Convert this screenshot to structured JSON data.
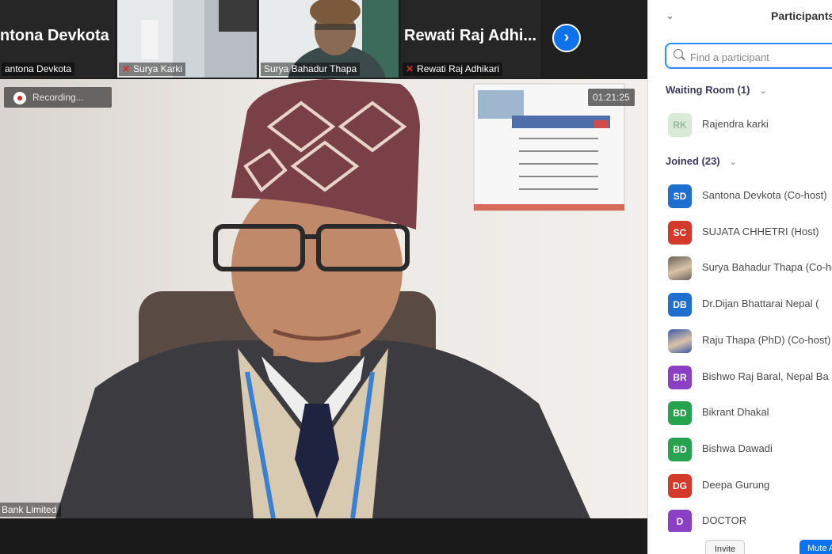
{
  "thumbnails": [
    {
      "big_name": "ntona Devkota",
      "caption": "antona Devkota",
      "muted": false
    },
    {
      "big_name": "",
      "caption": "Surya Karki",
      "muted": true
    },
    {
      "big_name": "",
      "caption": "Surya Bahadur Thapa",
      "muted": false
    },
    {
      "big_name": "Rewati  Raj  Adhi...",
      "caption": "Rewati Raj Adhikari",
      "muted": true
    }
  ],
  "next_arrow_glyph": "›",
  "recording_label": "Recording...",
  "timer": "01:21:25",
  "main_caption": "Bank Limited",
  "participants_panel": {
    "title": "Participants",
    "collapse_glyph": "⌄",
    "search_placeholder": "Find a participant",
    "waiting_room_header": "Waiting Room (1)",
    "joined_header": "Joined (23)",
    "section_chevron": "⌄",
    "waiting": [
      {
        "initials": "RK",
        "name": "Rajendra karki",
        "color": "#d8ead8"
      }
    ],
    "joined": [
      {
        "initials": "SD",
        "name": "Santona Devkota (Co-host)",
        "color": "#1f6fd1",
        "photo": false
      },
      {
        "initials": "SC",
        "name": "SUJATA CHHETRI (Host)",
        "color": "#d33a2c",
        "photo": false
      },
      {
        "initials": "",
        "name": "Surya Bahadur Thapa (Co-host)",
        "color": "#6b6156",
        "photo": true
      },
      {
        "initials": "DB",
        "name": "Dr.Dijan Bhattarai Nepal (",
        "color": "#1f6fd1",
        "photo": false
      },
      {
        "initials": "",
        "name": "Raju Thapa (PhD) (Co-host)",
        "color": "#3a5aa8",
        "photo": true
      },
      {
        "initials": "BR",
        "name": "Bishwo Raj Baral, Nepal Ba",
        "color": "#8a3fc4",
        "photo": false
      },
      {
        "initials": "BD",
        "name": "Bikrant Dhakal",
        "color": "#27a350",
        "photo": false
      },
      {
        "initials": "BD",
        "name": "Bishwa Dawadi",
        "color": "#27a350",
        "photo": false
      },
      {
        "initials": "DG",
        "name": "Deepa Gurung",
        "color": "#d33a2c",
        "photo": false
      },
      {
        "initials": "D",
        "name": "DOCTOR",
        "color": "#8a3fc4",
        "photo": false
      }
    ],
    "invite_label": "Invite",
    "mute_all_label": "Mute All"
  },
  "colors": {
    "accent": "#0e72ed",
    "muted_mic": "#e02828",
    "focus_border": "#2d8cff"
  }
}
